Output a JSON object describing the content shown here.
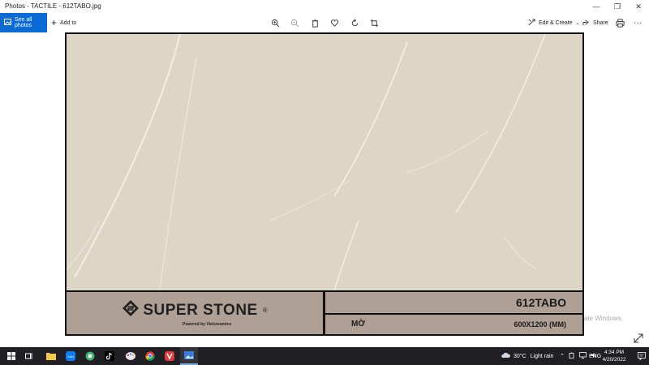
{
  "window": {
    "title": "Photos - TACTILE - 612TABO.jpg"
  },
  "toolbar": {
    "see_all_label": "See all photos",
    "add_to_label": "Add to",
    "edit_create_label": "Edit & Create",
    "share_label": "Share",
    "icons": [
      "zoom-in-icon",
      "zoom-out-icon",
      "delete-icon",
      "favorite-icon",
      "rotate-icon",
      "crop-icon",
      "print-icon"
    ]
  },
  "photo": {
    "brand": "SUPER STONE",
    "brand_mark": "®",
    "brand_sub": "Powered by Vietceramics",
    "product_code": "612TABO",
    "finish": "MỜ",
    "size": "600X1200 (MM)",
    "stone_color": "#ddd5c6",
    "panel_color": "#afa096"
  },
  "overlay": {
    "activate_line1": "ate Windows."
  },
  "taskbar": {
    "weather_temp": "30°C",
    "weather_text": "Light rain",
    "language": "ENG",
    "time": "4:34 PM",
    "date": "4/20/2022"
  }
}
